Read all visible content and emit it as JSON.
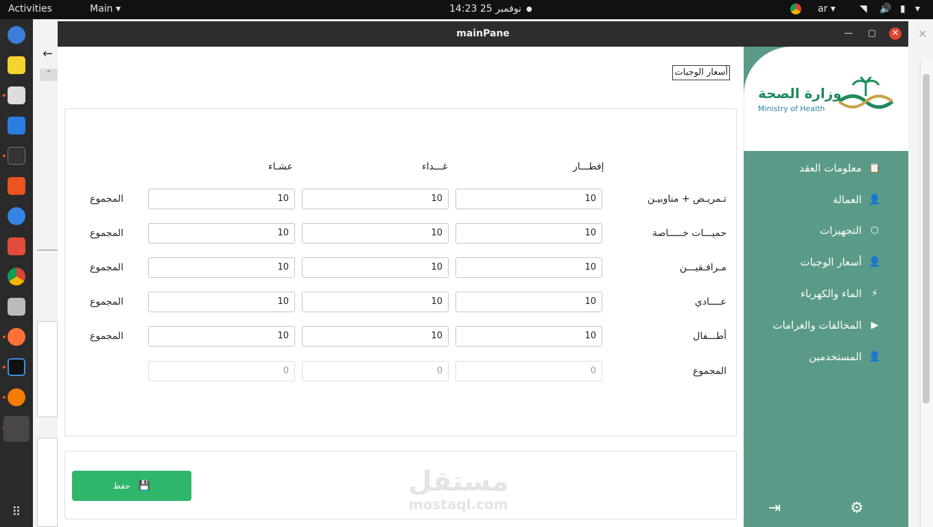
{
  "topbar": {
    "activities": "Activities",
    "app_menu": "Main",
    "datetime": "نوفمبر 25  14:23",
    "input_lang": "ar"
  },
  "window": {
    "title": "mainPane"
  },
  "page": {
    "title": "أسعار الوجبات"
  },
  "table": {
    "columns": [
      "إفطـــار",
      "غـــداء",
      "عشـاء"
    ],
    "rows": [
      {
        "label": "تـمريـض + مناوبيـن",
        "values": [
          "10",
          "10",
          "10"
        ],
        "total": "المجموع"
      },
      {
        "label": "حميـــات خـــــاصة",
        "values": [
          "10",
          "10",
          "10"
        ],
        "total": "المجموع"
      },
      {
        "label": "مـرافـقيـــن",
        "values": [
          "10",
          "10",
          "10"
        ],
        "total": "المجموع"
      },
      {
        "label": "عــــادي",
        "values": [
          "10",
          "10",
          "10"
        ],
        "total": "المجموع"
      },
      {
        "label": "أطـــفال",
        "values": [
          "10",
          "10",
          "10"
        ],
        "total": "المجموع"
      }
    ],
    "totals_row": {
      "label": "المجموع",
      "values": [
        "0",
        "0",
        "0"
      ]
    }
  },
  "actions": {
    "save_label": "حفظ"
  },
  "watermark": {
    "arabic": "مستقل",
    "latin": "mostaql.com"
  },
  "logo": {
    "arabic": "وزارة الصحة",
    "english": "Ministry of Health"
  },
  "sidebar": {
    "items": [
      {
        "label": "معلومات العقد",
        "icon": "clipboard-icon"
      },
      {
        "label": "العمالة",
        "icon": "user-icon"
      },
      {
        "label": "التجهيزات",
        "icon": "box-icon"
      },
      {
        "label": "أسعار الوجبات",
        "icon": "user-icon"
      },
      {
        "label": "الماء والكهرباء",
        "icon": "tower-icon"
      },
      {
        "label": "المخالفات والغرامات",
        "icon": "play-icon"
      },
      {
        "label": "المستخدمين",
        "icon": "user-icon"
      }
    ]
  },
  "colors": {
    "sidebar": "#5a9a88",
    "save": "#2eb66b",
    "titlebar": "#2d2d2d",
    "close": "#e0432f"
  }
}
